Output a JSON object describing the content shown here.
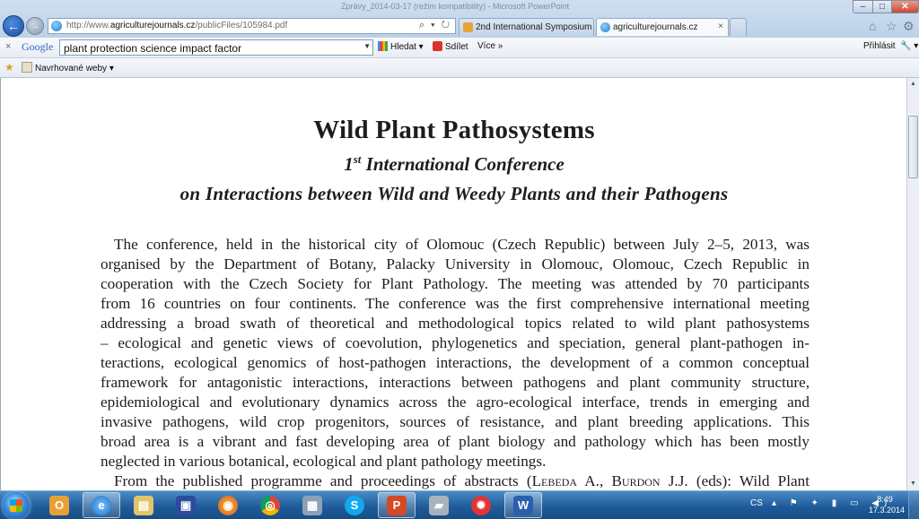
{
  "window": {
    "title": "Zprávy_2014-03-17 (režim kompatibility) - Microsoft PowerPoint",
    "min_glyph": "–",
    "max_glyph": "□",
    "close_glyph": "✕"
  },
  "browser": {
    "back_glyph": "←",
    "forward_glyph": "→",
    "address_prefix": "http://www.",
    "address_domain": "agriculturejournals.cz",
    "address_path": "/publicFiles/105984.pdf",
    "address_icons": "⌕ ▾ ↻",
    "tabs": [
      {
        "label": "2nd International Symposium ..."
      },
      {
        "label": "agriculturejournals.cz",
        "close": "×"
      }
    ],
    "home_glyph": "⌂",
    "favorites_glyph": "☆",
    "tools_glyph": "⚙"
  },
  "google_toolbar": {
    "close": "×",
    "logo": "Google",
    "search_value": "plant protection science impact factor",
    "dropdown_glyph": "▼",
    "search_label": "Hledat ▾",
    "share_label": "Sdílet",
    "more_label": "Více »",
    "sign_in_label": "Přihlásit",
    "wrench_glyph": "🔧 ▾"
  },
  "favorites_bar": {
    "star_glyph": "★",
    "suggested_label": "Navrhované weby ▾"
  },
  "document": {
    "title": "Wild Plant Pathosystems",
    "subtitle1_ordinal": "1",
    "subtitle1_sup": "st",
    "subtitle1_rest": " International Conference",
    "subtitle2": "on Interactions between Wild and Weedy Plants and their Pathogens",
    "lines": [
      "The conference, held in the historical city of Olomouc (Czech Republic) between July 2–5, 2013, was",
      "organised by the Department of Botany, Palacky University in Olomouc, Olomouc, Czech Republic in",
      "cooperation with the Czech Society for Plant Pathology. The meeting was attended by 70 participants",
      "from 16 countries on four continents. The conference was the first comprehensive international meeting",
      "addressing a broad swath of theoretical and methodological topics related to wild plant pathosystems",
      "– ecological and genetic views of coevolution, phylogenetics and speciation, general plant-pathogen in-",
      "teractions, ecological genomics of host-pathogen interactions, the development of a common conceptual",
      "framework for antagonistic interactions, interactions between pathogens and plant community structure,",
      "epidemiological and evolutionary dynamics across the agro-ecological interface, trends in emerging and",
      "invasive pathogens, wild crop progenitors, sources of resistance, and plant breeding applications. This",
      "broad area is a vibrant and fast developing area of plant biology and pathology which has been mostly",
      "neglected in various botanical, ecological and plant pathology meetings."
    ],
    "last_line_start": "From the published programme and proceedings of abstracts (",
    "last_line_name1": "Lebeda A.",
    "last_line_sep": ", ",
    "last_line_name2": "Burdon",
    "last_line_end": " J.J. (eds): Wild Plant"
  },
  "scrollbar": {
    "up_glyph": "▲",
    "down_glyph": "▼"
  },
  "taskbar": {
    "apps": [
      {
        "glyph": "O"
      },
      {
        "glyph": "e"
      },
      {
        "glyph": "▤"
      },
      {
        "glyph": "▣"
      },
      {
        "glyph": "◉"
      },
      {
        "glyph": "◎"
      },
      {
        "glyph": "▦"
      },
      {
        "glyph": "S"
      },
      {
        "glyph": "P"
      },
      {
        "glyph": "▰"
      },
      {
        "glyph": "✹"
      },
      {
        "glyph": "W"
      }
    ],
    "language": "CS",
    "tray_icons": "▴ ⚑ ✦ ▮ ▭ ◀)",
    "time": "8:49",
    "date": "17.3.2014"
  }
}
